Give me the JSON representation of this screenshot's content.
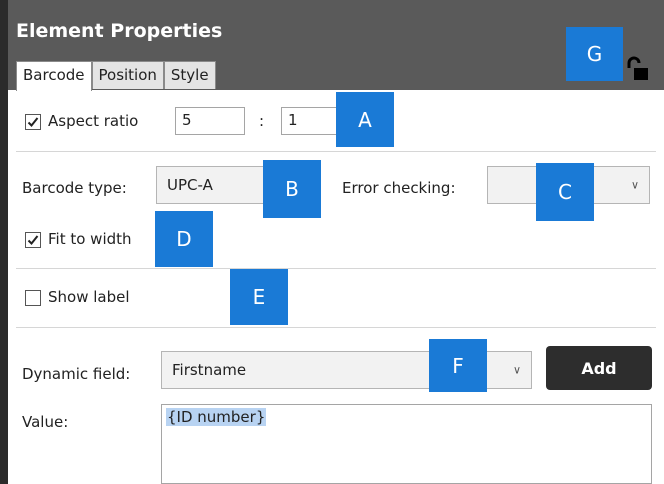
{
  "panel": {
    "title": "Element Properties",
    "tabs": [
      {
        "label": "Barcode",
        "active": true
      },
      {
        "label": "Position",
        "active": false
      },
      {
        "label": "Style",
        "active": false
      }
    ],
    "lock_icon": "unlocked-padlock-icon"
  },
  "aspect": {
    "label": "Aspect ratio",
    "checked": true,
    "width_value": "5",
    "separator": ":",
    "height_value": "1"
  },
  "barcode": {
    "type_label": "Barcode type:",
    "type_value": "UPC-A",
    "error_label": "Error checking:",
    "error_value": "",
    "fit_label": "Fit to width",
    "fit_checked": true
  },
  "label_section": {
    "show_label": "Show label",
    "checked": false
  },
  "dynamic": {
    "field_label": "Dynamic field:",
    "field_value": "Firstname",
    "add_label": "Add",
    "value_label": "Value:",
    "value_text": "{ID number}"
  },
  "annotations": {
    "A": "A",
    "B": "B",
    "C": "C",
    "D": "D",
    "E": "E",
    "F": "F",
    "G": "G"
  },
  "colors": {
    "header_bg": "#5a5a5a",
    "badge_bg": "#1a7ad6",
    "add_button_bg": "#2d2d2d",
    "selection_bg": "#b8d3f2"
  }
}
